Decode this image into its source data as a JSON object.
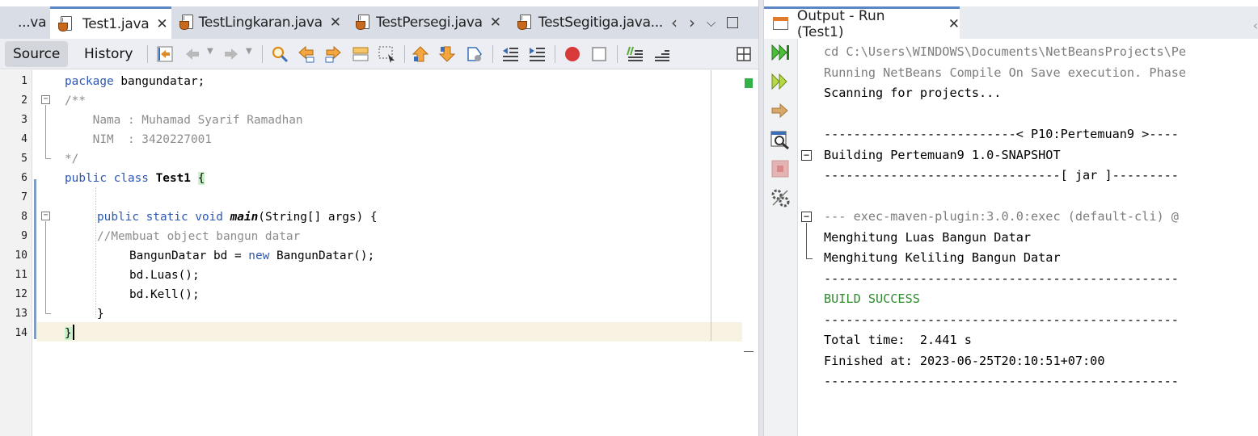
{
  "editor": {
    "tabs": [
      {
        "label": "...va",
        "closable": false,
        "active": false
      },
      {
        "label": "Test1.java",
        "closable": true,
        "active": true
      },
      {
        "label": "TestLingkaran.java",
        "closable": true,
        "active": false
      },
      {
        "label": "TestPersegi.java",
        "closable": true,
        "active": false
      },
      {
        "label": "TestSegitiga.java...",
        "closable": false,
        "active": false
      }
    ],
    "toolbar": {
      "source_label": "Source",
      "history_label": "History"
    },
    "lines": [
      {
        "num": "1"
      },
      {
        "num": "2"
      },
      {
        "num": "3"
      },
      {
        "num": "4"
      },
      {
        "num": "5"
      },
      {
        "num": "6"
      },
      {
        "num": "7"
      },
      {
        "num": "8"
      },
      {
        "num": "9"
      },
      {
        "num": "10"
      },
      {
        "num": "11"
      },
      {
        "num": "12"
      },
      {
        "num": "13"
      },
      {
        "num": "14"
      }
    ],
    "code": {
      "l1_kw": "package",
      "l1_rest": " bangundatar;",
      "l2": "/**",
      "l3": "    Nama : Muhamad Syarif Ramadhan",
      "l4": "    NIM  : 3420227001",
      "l5": "*/",
      "l6_kw": "public class",
      "l6_name": " Test1 ",
      "l6_brace": "{",
      "l8_kw": "public static void",
      "l8_method": "main",
      "l8_rest": "(String[] args) {",
      "l9": "//Membuat object bangun datar",
      "l10_a": "BangunDatar bd = ",
      "l10_kw": "new",
      "l10_b": " BangunDatar();",
      "l11": "bd.Luas();",
      "l12": "bd.Kell();",
      "l13": "}",
      "l14": "}"
    }
  },
  "output": {
    "tab_label": "Output - Run (Test1)",
    "lines": {
      "cd": "cd C:\\Users\\WINDOWS\\Documents\\NetBeansProjects\\Pe",
      "running": "Running NetBeans Compile On Save execution. Phase",
      "scanning": "Scanning for projects...",
      "sep_project": "--------------------------< P10:Pertemuan9 >----",
      "building": "Building Pertemuan9 1.0-SNAPSHOT",
      "sep_jar": "--------------------------------[ jar ]---------",
      "exec": "--- exec-maven-plugin:3.0.0:exec (default-cli) @",
      "luas": "Menghitung Luas Bangun Datar",
      "keliling": "Menghitung Keliling Bangun Datar",
      "sep1": "------------------------------------------------",
      "build_success": "BUILD SUCCESS",
      "sep2": "------------------------------------------------",
      "total_time": "Total time:  2.441 s",
      "finished": "Finished at: 2023-06-25T20:10:51+07:00",
      "sep3": "------------------------------------------------"
    }
  },
  "colors": {
    "keyword": "#2c57b5",
    "comment": "#8c8c8c",
    "success": "#2e8b2e",
    "ok_marker": "#35b14a",
    "active_tab_accent": "#5b86c4"
  }
}
